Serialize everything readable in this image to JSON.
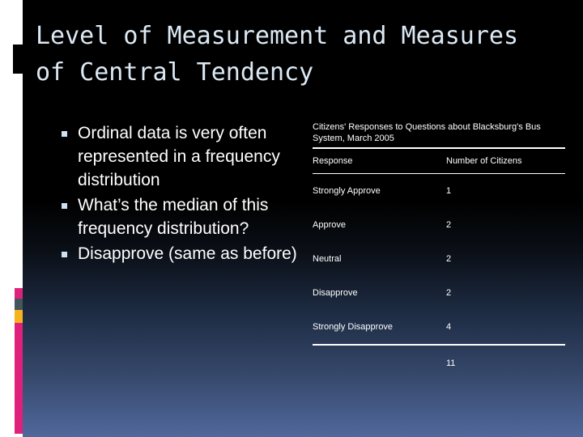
{
  "slide": {
    "title": "Level of Measurement and Measures of Central Tendency",
    "background_top_color": "#000000",
    "background_bottom_color": "#50689c",
    "title_color": "#dce9f5",
    "bullet_marker_color": "#cfe0f2",
    "accent_colors": {
      "pink": "#e0217c",
      "slate": "#45555c",
      "gold": "#f5b41b"
    }
  },
  "bullets": [
    {
      "text": "Ordinal data is very often represented in a frequency distribution"
    },
    {
      "text": "What’s the median of this frequency distribution?"
    },
    {
      "text": "Disapprove (same as before)"
    }
  ],
  "table": {
    "caption": "Citizens' Responses to Questions about Blacksburg's Bus System, March 2005",
    "columns": [
      "Response",
      "Number of Citizens"
    ],
    "rows": [
      {
        "response": "Strongly Approve",
        "count": "1"
      },
      {
        "response": "Approve",
        "count": "2"
      },
      {
        "response": "Neutral",
        "count": "2"
      },
      {
        "response": "Disapprove",
        "count": "2"
      },
      {
        "response": "Strongly Disapprove",
        "count": "4"
      }
    ],
    "total_label": "",
    "total": "11"
  },
  "chart_data": {
    "type": "table",
    "title": "Citizens' Responses to Questions about Blacksburg's Bus System, March 2005",
    "categories": [
      "Strongly Approve",
      "Approve",
      "Neutral",
      "Disapprove",
      "Strongly Disapprove"
    ],
    "values": [
      1,
      2,
      2,
      2,
      4
    ],
    "xlabel": "Response",
    "ylabel": "Number of Citizens",
    "total": 11
  }
}
